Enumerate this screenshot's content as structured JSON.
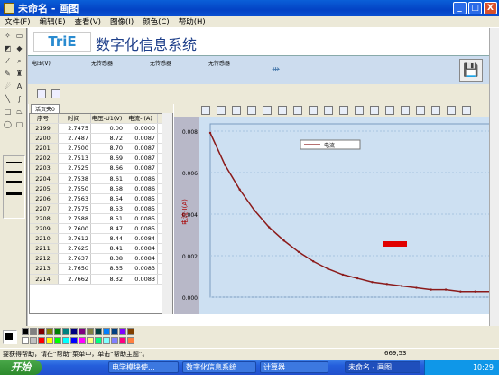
{
  "window": {
    "title": "未命名 - 画图",
    "min": "_",
    "max": "□",
    "close": "X"
  },
  "menu": [
    "文件(F)",
    "编辑(E)",
    "查看(V)",
    "图像(I)",
    "颜色(C)",
    "帮助(H)"
  ],
  "app": {
    "logo": "TriE",
    "title": "数字化信息系统"
  },
  "sensors": [
    {
      "label": "电压(V)"
    },
    {
      "label": "无传感器"
    },
    {
      "label": "无传感器"
    },
    {
      "label": "无传感器"
    }
  ],
  "tab": "活页夹0",
  "table": {
    "headers": [
      "序号",
      "时间",
      "电压-U1(V)",
      "电流-I(A)"
    ],
    "rows": [
      [
        "2199",
        "2.7475",
        "0.00",
        "0.0000"
      ],
      [
        "2200",
        "2.7487",
        "8.72",
        "0.0087"
      ],
      [
        "2201",
        "2.7500",
        "8.70",
        "0.0087"
      ],
      [
        "2202",
        "2.7513",
        "8.69",
        "0.0087"
      ],
      [
        "2203",
        "2.7525",
        "8.66",
        "0.0087"
      ],
      [
        "2204",
        "2.7538",
        "8.61",
        "0.0086"
      ],
      [
        "2205",
        "2.7550",
        "8.58",
        "0.0086"
      ],
      [
        "2206",
        "2.7563",
        "8.54",
        "0.0085"
      ],
      [
        "2207",
        "2.7575",
        "8.53",
        "0.0085"
      ],
      [
        "2208",
        "2.7588",
        "8.51",
        "0.0085"
      ],
      [
        "2209",
        "2.7600",
        "8.47",
        "0.0085"
      ],
      [
        "2210",
        "2.7612",
        "8.44",
        "0.0084"
      ],
      [
        "2211",
        "2.7625",
        "8.41",
        "0.0084"
      ],
      [
        "2212",
        "2.7637",
        "8.38",
        "0.0084"
      ],
      [
        "2213",
        "2.7650",
        "8.35",
        "0.0083"
      ],
      [
        "2214",
        "2.7662",
        "8.32",
        "0.0083"
      ]
    ]
  },
  "chart_data": {
    "type": "line",
    "ylabel": "电流-I(A)",
    "legend": "电流",
    "yticks": [
      "0.008",
      "0.006",
      "0.004",
      "0.002",
      "0.000"
    ],
    "ylim": [
      0,
      0.0087
    ],
    "series": [
      {
        "name": "电流",
        "values": [
          0.0087,
          0.007,
          0.0057,
          0.0046,
          0.0037,
          0.003,
          0.0024,
          0.0019,
          0.0015,
          0.0012,
          0.001,
          0.0008,
          0.0007,
          0.0006,
          0.0005,
          0.0004,
          0.0004,
          0.0003,
          0.0003,
          0.0003
        ]
      }
    ],
    "colors": {
      "line": "#8b1a1a",
      "background": "#cde0f2",
      "marker": "#e00000"
    }
  },
  "status": {
    "help": "要获得帮助，请在“帮助”菜单中，单击“帮助主题”。",
    "coords": "669,53"
  },
  "taskbar": {
    "start": "开始",
    "items": [
      "电学模块使...",
      "数字化信息系统",
      "计算器",
      "未命名 - 画图"
    ],
    "time": "10:29"
  }
}
